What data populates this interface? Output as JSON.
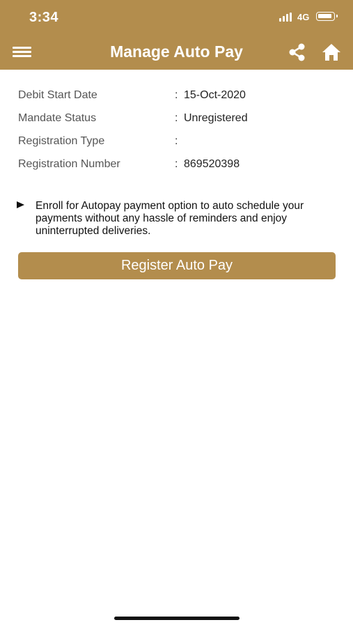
{
  "status_bar": {
    "time": "3:34",
    "network": "4G",
    "icons": [
      "signal-bars-icon",
      "battery-icon"
    ]
  },
  "header": {
    "title": "Manage Auto Pay",
    "icons": [
      "menu-icon",
      "share-icon",
      "home-icon"
    ]
  },
  "details": [
    {
      "label": "Debit Start Date",
      "colon": ":",
      "value": "15-Oct-2020"
    },
    {
      "label": "Mandate Status",
      "colon": ":",
      "value": "Unregistered"
    },
    {
      "label": "Registration Type",
      "colon": ":",
      "value": ""
    },
    {
      "label": "Registration Number",
      "colon": ":",
      "value": "869520398"
    }
  ],
  "info": {
    "icon": "bullet-triangle-icon",
    "text": "Enroll for Autopay payment option to auto schedule your payments without any hassle of reminders and enjoy uninterrupted deliveries."
  },
  "register_button": {
    "label": "Register Auto Pay"
  },
  "colors": {
    "brand": "#b38d4d",
    "background": "#ffffff"
  }
}
